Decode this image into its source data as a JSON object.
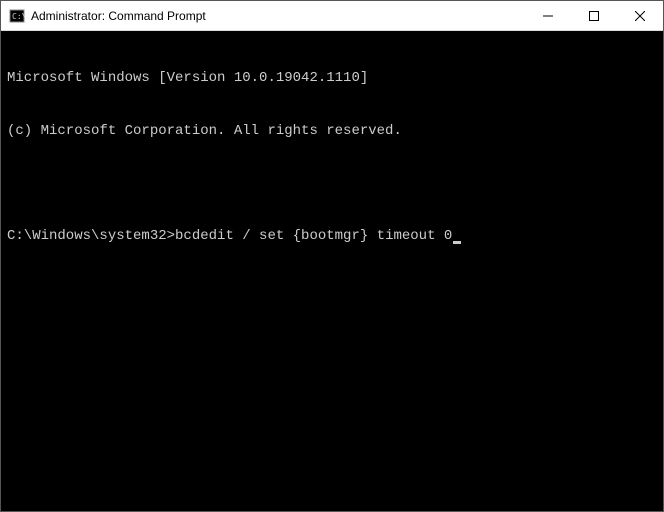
{
  "window": {
    "title": "Administrator: Command Prompt"
  },
  "terminal": {
    "line1": "Microsoft Windows [Version 10.0.19042.1110]",
    "line2": "(c) Microsoft Corporation. All rights reserved.",
    "prompt": "C:\\Windows\\system32>",
    "command": "bcdedit / set {bootmgr} timeout 0"
  }
}
